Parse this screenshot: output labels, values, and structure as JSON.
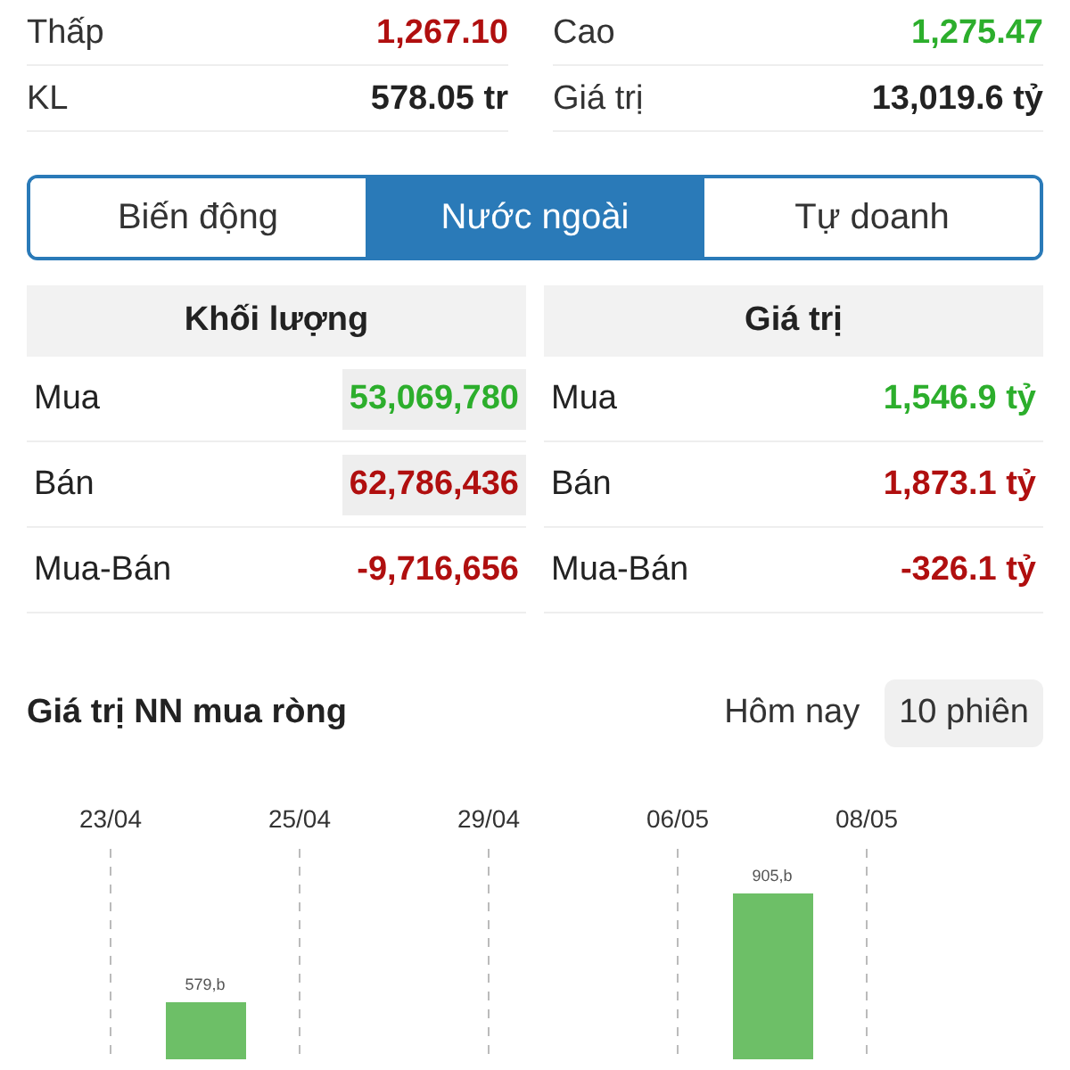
{
  "summary": [
    {
      "label": "Thấp",
      "value": "1,267.10",
      "color": "#b00f0f"
    },
    {
      "label": "Cao",
      "value": "1,275.47",
      "color": "#2cae2c"
    },
    {
      "label": "KL",
      "value": "578.05 tr",
      "color": "#222222"
    },
    {
      "label": "Giá trị",
      "value": "13,019.6 tỷ",
      "color": "#222222"
    }
  ],
  "tabs": [
    {
      "label": "Biến động",
      "selected": false
    },
    {
      "label": "Nước ngoài",
      "selected": true
    },
    {
      "label": "Tự doanh",
      "selected": false
    }
  ],
  "tables": [
    {
      "title": "Khối lượng",
      "rows": [
        {
          "label": "Mua",
          "value": "53,069,780",
          "color": "#2cae2c",
          "highlighted": true
        },
        {
          "label": "Bán",
          "value": "62,786,436",
          "color": "#b00f0f",
          "highlighted": true
        },
        {
          "label": "Mua-Bán",
          "value": "-9,716,656",
          "color": "#b00f0f",
          "highlighted": false
        }
      ]
    },
    {
      "title": "Giá trị",
      "rows": [
        {
          "label": "Mua",
          "value": "1,546.9 tỷ",
          "color": "#2cae2c",
          "highlighted": false
        },
        {
          "label": "Bán",
          "value": "1,873.1 tỷ",
          "color": "#b00f0f",
          "highlighted": false
        },
        {
          "label": "Mua-Bán",
          "value": "-326.1 tỷ",
          "color": "#b00f0f",
          "highlighted": false
        }
      ]
    }
  ],
  "section": {
    "title": "Giá trị NN mua ròng",
    "periods": [
      {
        "label": "Hôm nay",
        "selected": false
      },
      {
        "label": "10 phiên",
        "selected": true
      }
    ],
    "chart": {
      "dates": [
        "23/04",
        "25/04",
        "29/04",
        "06/05",
        "08/05"
      ],
      "bars": [
        {
          "label": "579,b"
        },
        {
          "label": "905,b"
        }
      ]
    }
  }
}
